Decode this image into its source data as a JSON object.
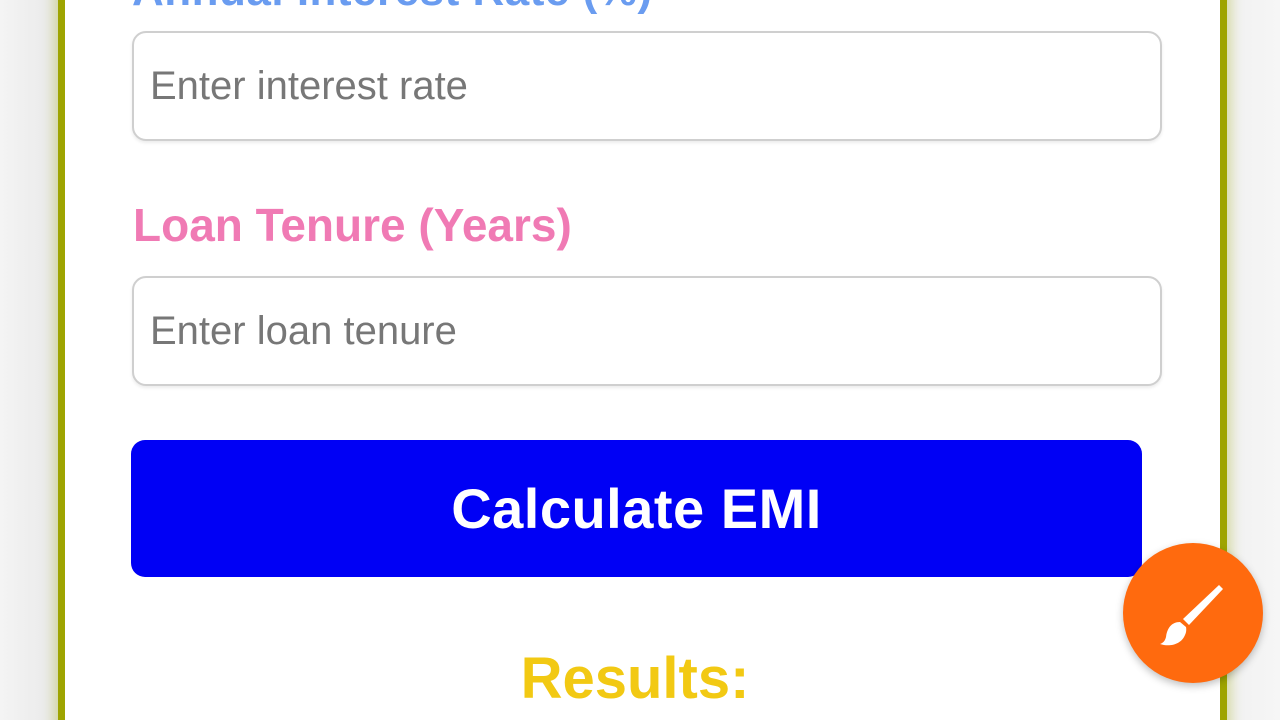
{
  "form": {
    "interest_label_cut": "Annual Interest Rate (%)",
    "interest_placeholder": "Enter interest rate",
    "tenure_label": "Loan Tenure (Years)",
    "tenure_placeholder": "Enter loan tenure",
    "calculate_label": "Calculate EMI"
  },
  "results": {
    "title": "Results:"
  },
  "fab": {
    "icon": "paintbrush-icon"
  },
  "colors": {
    "card_border": "#9ea400",
    "interest_label": "#6a9cf0",
    "tenure_label": "#f07ab4",
    "button": "#0000f5",
    "results_title": "#f2c913",
    "fab": "#ff6a0e"
  }
}
